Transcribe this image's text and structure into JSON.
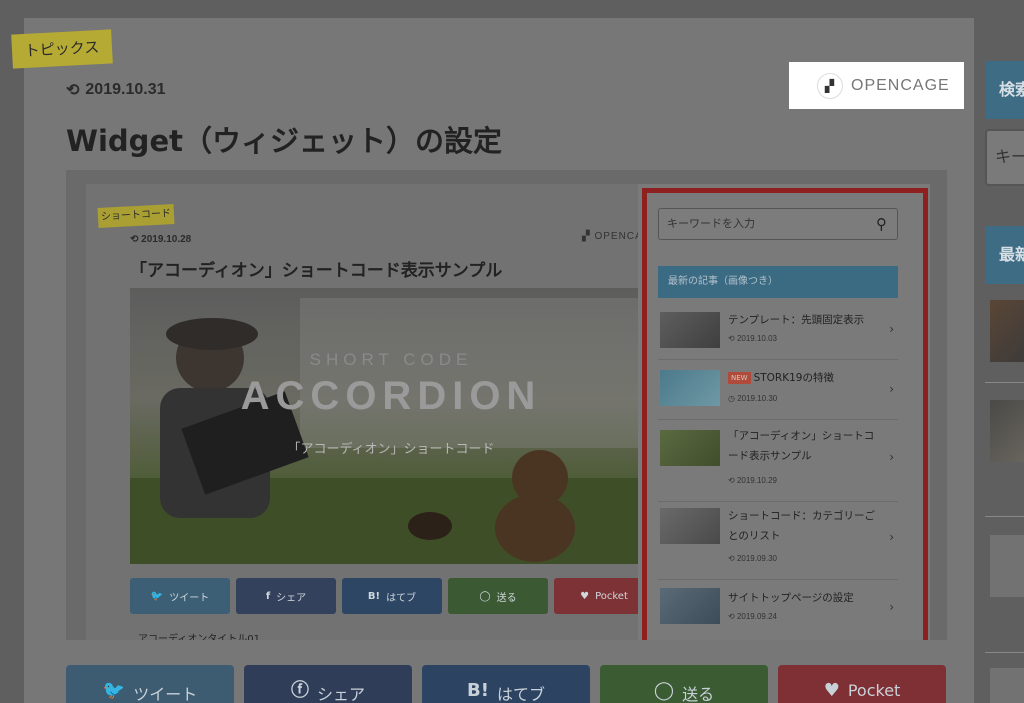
{
  "category_tag": "トピックス",
  "post_date": "2019.10.31",
  "brand": "OPENCAGE",
  "title": "Widget（ウィジェット）の設定",
  "sidebar": {
    "search_heading": "検索",
    "search_placeholder": "キー",
    "latest_heading": "最新"
  },
  "screenshot": {
    "category_tag": "ショートコード",
    "date": "2019.10.28",
    "brand": "OPENCAGE",
    "title": "「アコーディオン」ショートコード表示サンプル",
    "hero": {
      "sub": "SHORT CODE",
      "big": "ACCORDION",
      "jp": "「アコーディオン」ショートコード"
    },
    "shares": [
      {
        "label": "ツイート",
        "icon": "twitter-icon",
        "color": "#3c5f75"
      },
      {
        "label": "シェア",
        "icon": "facebook-icon",
        "color": "#34415c"
      },
      {
        "label": "はてブ",
        "icon": "hatena-icon",
        "color": "#2d4664"
      },
      {
        "label": "送る",
        "icon": "line-icon",
        "color": "#3b5a33"
      },
      {
        "label": "Pocket",
        "icon": "pocket-icon",
        "color": "#7d3236"
      }
    ],
    "accordion_title": "アコーディオンタイトル01",
    "widget": {
      "search_placeholder": "キーワードを入力",
      "heading": "最新の記事（画像つき）",
      "items": [
        {
          "title": "テンプレート：先頭固定表示",
          "date": "2019.10.03",
          "new": false
        },
        {
          "title": "STORK19の特徴",
          "date": "2019.10.30",
          "new": true,
          "badge": "NEW"
        },
        {
          "title": "「アコーディオン」ショートコード表示サンプル",
          "date": "2019.10.29",
          "new": false
        },
        {
          "title": "ショートコード：カテゴリーごとのリスト",
          "date": "2019.09.30",
          "new": false
        },
        {
          "title": "サイトトップページの設定",
          "date": "2019.09.24",
          "new": false
        }
      ]
    }
  },
  "shares": [
    {
      "label": "ツイート",
      "icon": "twitter-icon",
      "color": "#3d5c72"
    },
    {
      "label": "シェア",
      "icon": "facebook-icon",
      "color": "#2f3d58"
    },
    {
      "label": "はてブ",
      "icon": "hatena-icon",
      "color": "#2c4461"
    },
    {
      "label": "送る",
      "icon": "line-icon",
      "color": "#3b5b33"
    },
    {
      "label": "Pocket",
      "icon": "pocket-icon",
      "color": "#7f3034"
    }
  ]
}
